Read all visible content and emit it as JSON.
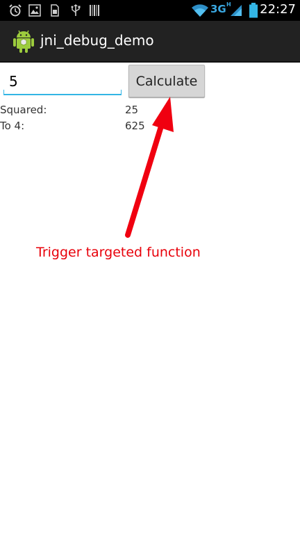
{
  "status_bar": {
    "time": "22:27",
    "network": "3G",
    "network_sub": "H",
    "icons": [
      "alarm-icon",
      "photo-icon",
      "sim-icon",
      "usb-icon",
      "barcode-icon",
      "wifi-icon",
      "signal-icon",
      "battery-icon"
    ]
  },
  "action_bar": {
    "title": "jni_debug_demo",
    "icon": "android-icon"
  },
  "form": {
    "input_value": "5",
    "button_label": "Calculate"
  },
  "results": [
    {
      "label": "Squared:",
      "value": "25"
    },
    {
      "label": "To 4:",
      "value": "625"
    }
  ],
  "annotation": {
    "text": "Trigger targeted function",
    "color": "#e8000a"
  },
  "colors": {
    "accent": "#33b5e5",
    "statusbar": "#000000",
    "actionbar": "#222222",
    "annotation": "#e8000a"
  }
}
